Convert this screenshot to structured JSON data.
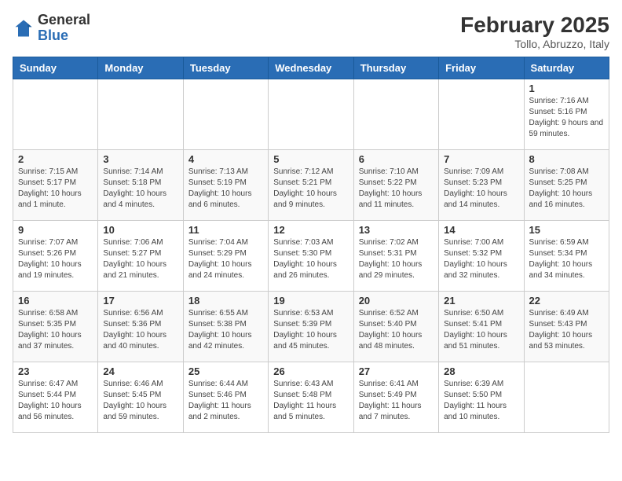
{
  "logo": {
    "general": "General",
    "blue": "Blue"
  },
  "calendar": {
    "title": "February 2025",
    "subtitle": "Tollo, Abruzzo, Italy"
  },
  "headers": [
    "Sunday",
    "Monday",
    "Tuesday",
    "Wednesday",
    "Thursday",
    "Friday",
    "Saturday"
  ],
  "weeks": [
    [
      {
        "day": "",
        "info": ""
      },
      {
        "day": "",
        "info": ""
      },
      {
        "day": "",
        "info": ""
      },
      {
        "day": "",
        "info": ""
      },
      {
        "day": "",
        "info": ""
      },
      {
        "day": "",
        "info": ""
      },
      {
        "day": "1",
        "info": "Sunrise: 7:16 AM\nSunset: 5:16 PM\nDaylight: 9 hours and 59 minutes."
      }
    ],
    [
      {
        "day": "2",
        "info": "Sunrise: 7:15 AM\nSunset: 5:17 PM\nDaylight: 10 hours and 1 minute."
      },
      {
        "day": "3",
        "info": "Sunrise: 7:14 AM\nSunset: 5:18 PM\nDaylight: 10 hours and 4 minutes."
      },
      {
        "day": "4",
        "info": "Sunrise: 7:13 AM\nSunset: 5:19 PM\nDaylight: 10 hours and 6 minutes."
      },
      {
        "day": "5",
        "info": "Sunrise: 7:12 AM\nSunset: 5:21 PM\nDaylight: 10 hours and 9 minutes."
      },
      {
        "day": "6",
        "info": "Sunrise: 7:10 AM\nSunset: 5:22 PM\nDaylight: 10 hours and 11 minutes."
      },
      {
        "day": "7",
        "info": "Sunrise: 7:09 AM\nSunset: 5:23 PM\nDaylight: 10 hours and 14 minutes."
      },
      {
        "day": "8",
        "info": "Sunrise: 7:08 AM\nSunset: 5:25 PM\nDaylight: 10 hours and 16 minutes."
      }
    ],
    [
      {
        "day": "9",
        "info": "Sunrise: 7:07 AM\nSunset: 5:26 PM\nDaylight: 10 hours and 19 minutes."
      },
      {
        "day": "10",
        "info": "Sunrise: 7:06 AM\nSunset: 5:27 PM\nDaylight: 10 hours and 21 minutes."
      },
      {
        "day": "11",
        "info": "Sunrise: 7:04 AM\nSunset: 5:29 PM\nDaylight: 10 hours and 24 minutes."
      },
      {
        "day": "12",
        "info": "Sunrise: 7:03 AM\nSunset: 5:30 PM\nDaylight: 10 hours and 26 minutes."
      },
      {
        "day": "13",
        "info": "Sunrise: 7:02 AM\nSunset: 5:31 PM\nDaylight: 10 hours and 29 minutes."
      },
      {
        "day": "14",
        "info": "Sunrise: 7:00 AM\nSunset: 5:32 PM\nDaylight: 10 hours and 32 minutes."
      },
      {
        "day": "15",
        "info": "Sunrise: 6:59 AM\nSunset: 5:34 PM\nDaylight: 10 hours and 34 minutes."
      }
    ],
    [
      {
        "day": "16",
        "info": "Sunrise: 6:58 AM\nSunset: 5:35 PM\nDaylight: 10 hours and 37 minutes."
      },
      {
        "day": "17",
        "info": "Sunrise: 6:56 AM\nSunset: 5:36 PM\nDaylight: 10 hours and 40 minutes."
      },
      {
        "day": "18",
        "info": "Sunrise: 6:55 AM\nSunset: 5:38 PM\nDaylight: 10 hours and 42 minutes."
      },
      {
        "day": "19",
        "info": "Sunrise: 6:53 AM\nSunset: 5:39 PM\nDaylight: 10 hours and 45 minutes."
      },
      {
        "day": "20",
        "info": "Sunrise: 6:52 AM\nSunset: 5:40 PM\nDaylight: 10 hours and 48 minutes."
      },
      {
        "day": "21",
        "info": "Sunrise: 6:50 AM\nSunset: 5:41 PM\nDaylight: 10 hours and 51 minutes."
      },
      {
        "day": "22",
        "info": "Sunrise: 6:49 AM\nSunset: 5:43 PM\nDaylight: 10 hours and 53 minutes."
      }
    ],
    [
      {
        "day": "23",
        "info": "Sunrise: 6:47 AM\nSunset: 5:44 PM\nDaylight: 10 hours and 56 minutes."
      },
      {
        "day": "24",
        "info": "Sunrise: 6:46 AM\nSunset: 5:45 PM\nDaylight: 10 hours and 59 minutes."
      },
      {
        "day": "25",
        "info": "Sunrise: 6:44 AM\nSunset: 5:46 PM\nDaylight: 11 hours and 2 minutes."
      },
      {
        "day": "26",
        "info": "Sunrise: 6:43 AM\nSunset: 5:48 PM\nDaylight: 11 hours and 5 minutes."
      },
      {
        "day": "27",
        "info": "Sunrise: 6:41 AM\nSunset: 5:49 PM\nDaylight: 11 hours and 7 minutes."
      },
      {
        "day": "28",
        "info": "Sunrise: 6:39 AM\nSunset: 5:50 PM\nDaylight: 11 hours and 10 minutes."
      },
      {
        "day": "",
        "info": ""
      }
    ]
  ]
}
